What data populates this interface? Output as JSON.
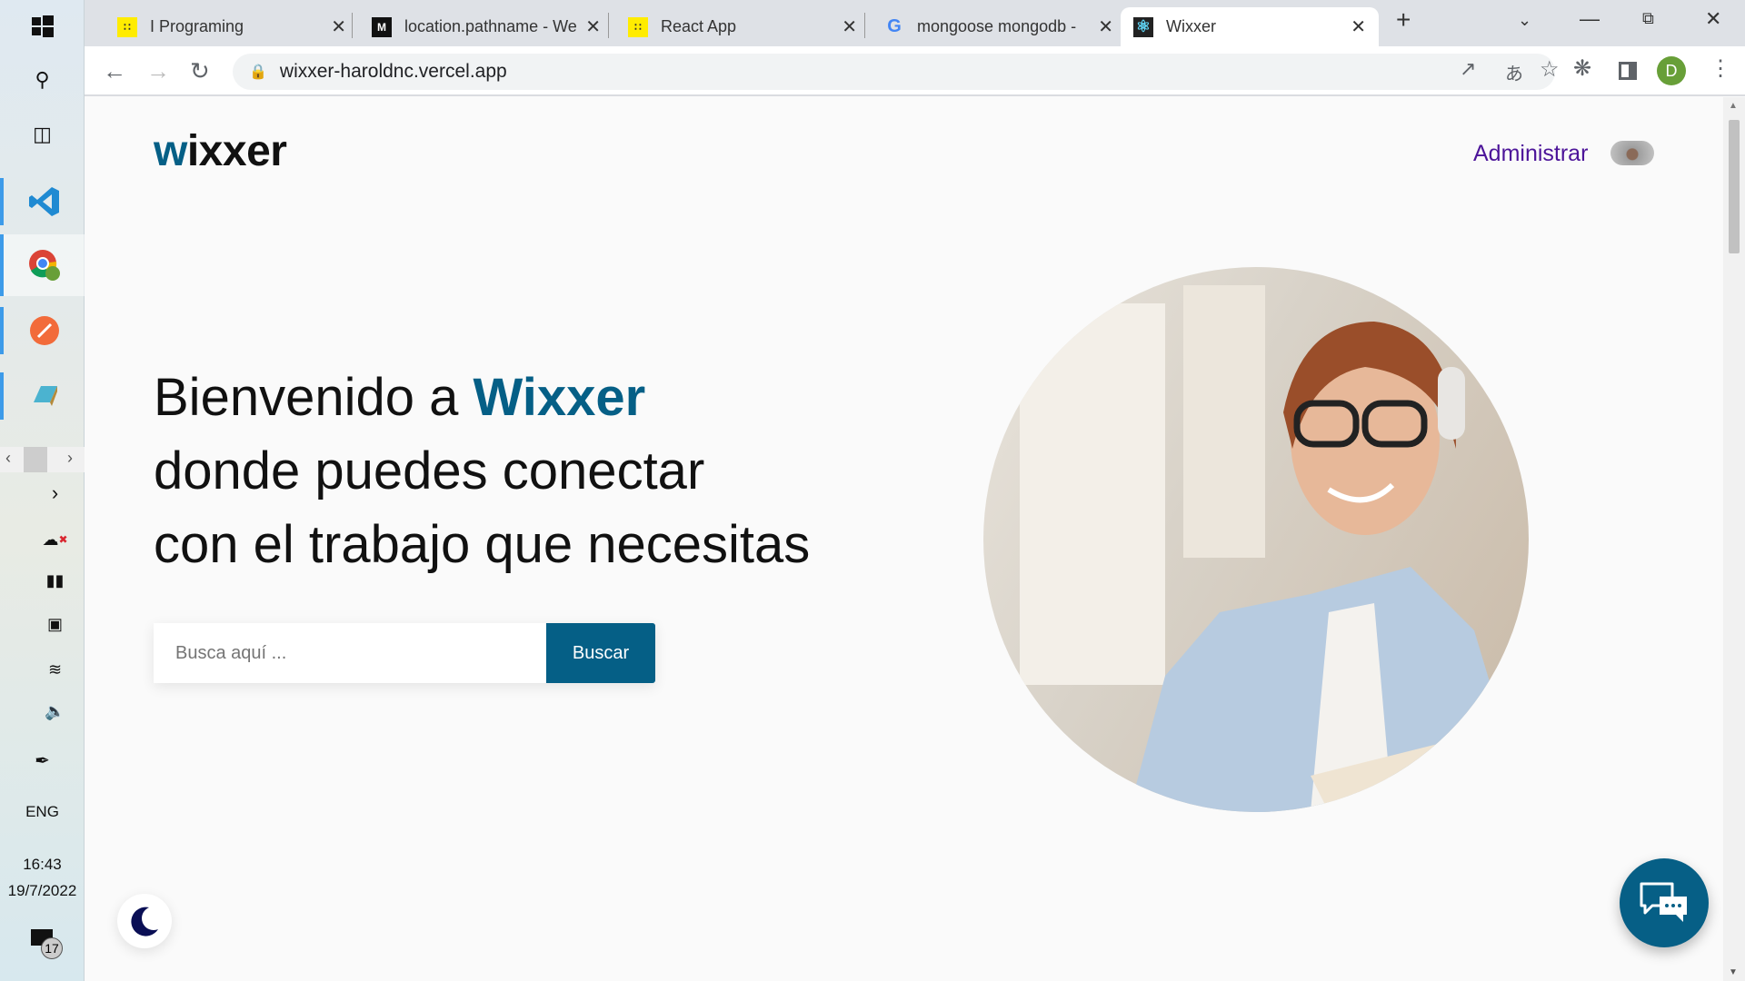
{
  "taskbar": {
    "lang": "ENG",
    "time": "16:43",
    "date": "19/7/2022",
    "notifications": "17"
  },
  "browser": {
    "tabs": [
      {
        "title": "I Programing",
        "icon": "iprogramming-favicon"
      },
      {
        "title": "location.pathname - We",
        "icon": "mdn-favicon"
      },
      {
        "title": "React App",
        "icon": "iprogramming-favicon"
      },
      {
        "title": "mongoose mongodb -",
        "icon": "google-favicon"
      },
      {
        "title": "Wixxer",
        "icon": "react-favicon",
        "active": true
      }
    ],
    "url": "wixxer-haroldnc.vercel.app",
    "profile_initial": "D",
    "profile_color": "#689f38"
  },
  "page": {
    "logo_first": "w",
    "logo_rest": "ixxer",
    "admin_link": "Administrar",
    "hero": {
      "line1_prefix": "Bienvenido a ",
      "brand": "Wixxer",
      "line2": "donde puedes conectar",
      "line3": "con el trabajo que necesitas"
    },
    "search": {
      "placeholder": "Busca aquí ...",
      "button": "Buscar"
    },
    "accent": "#055f86"
  }
}
